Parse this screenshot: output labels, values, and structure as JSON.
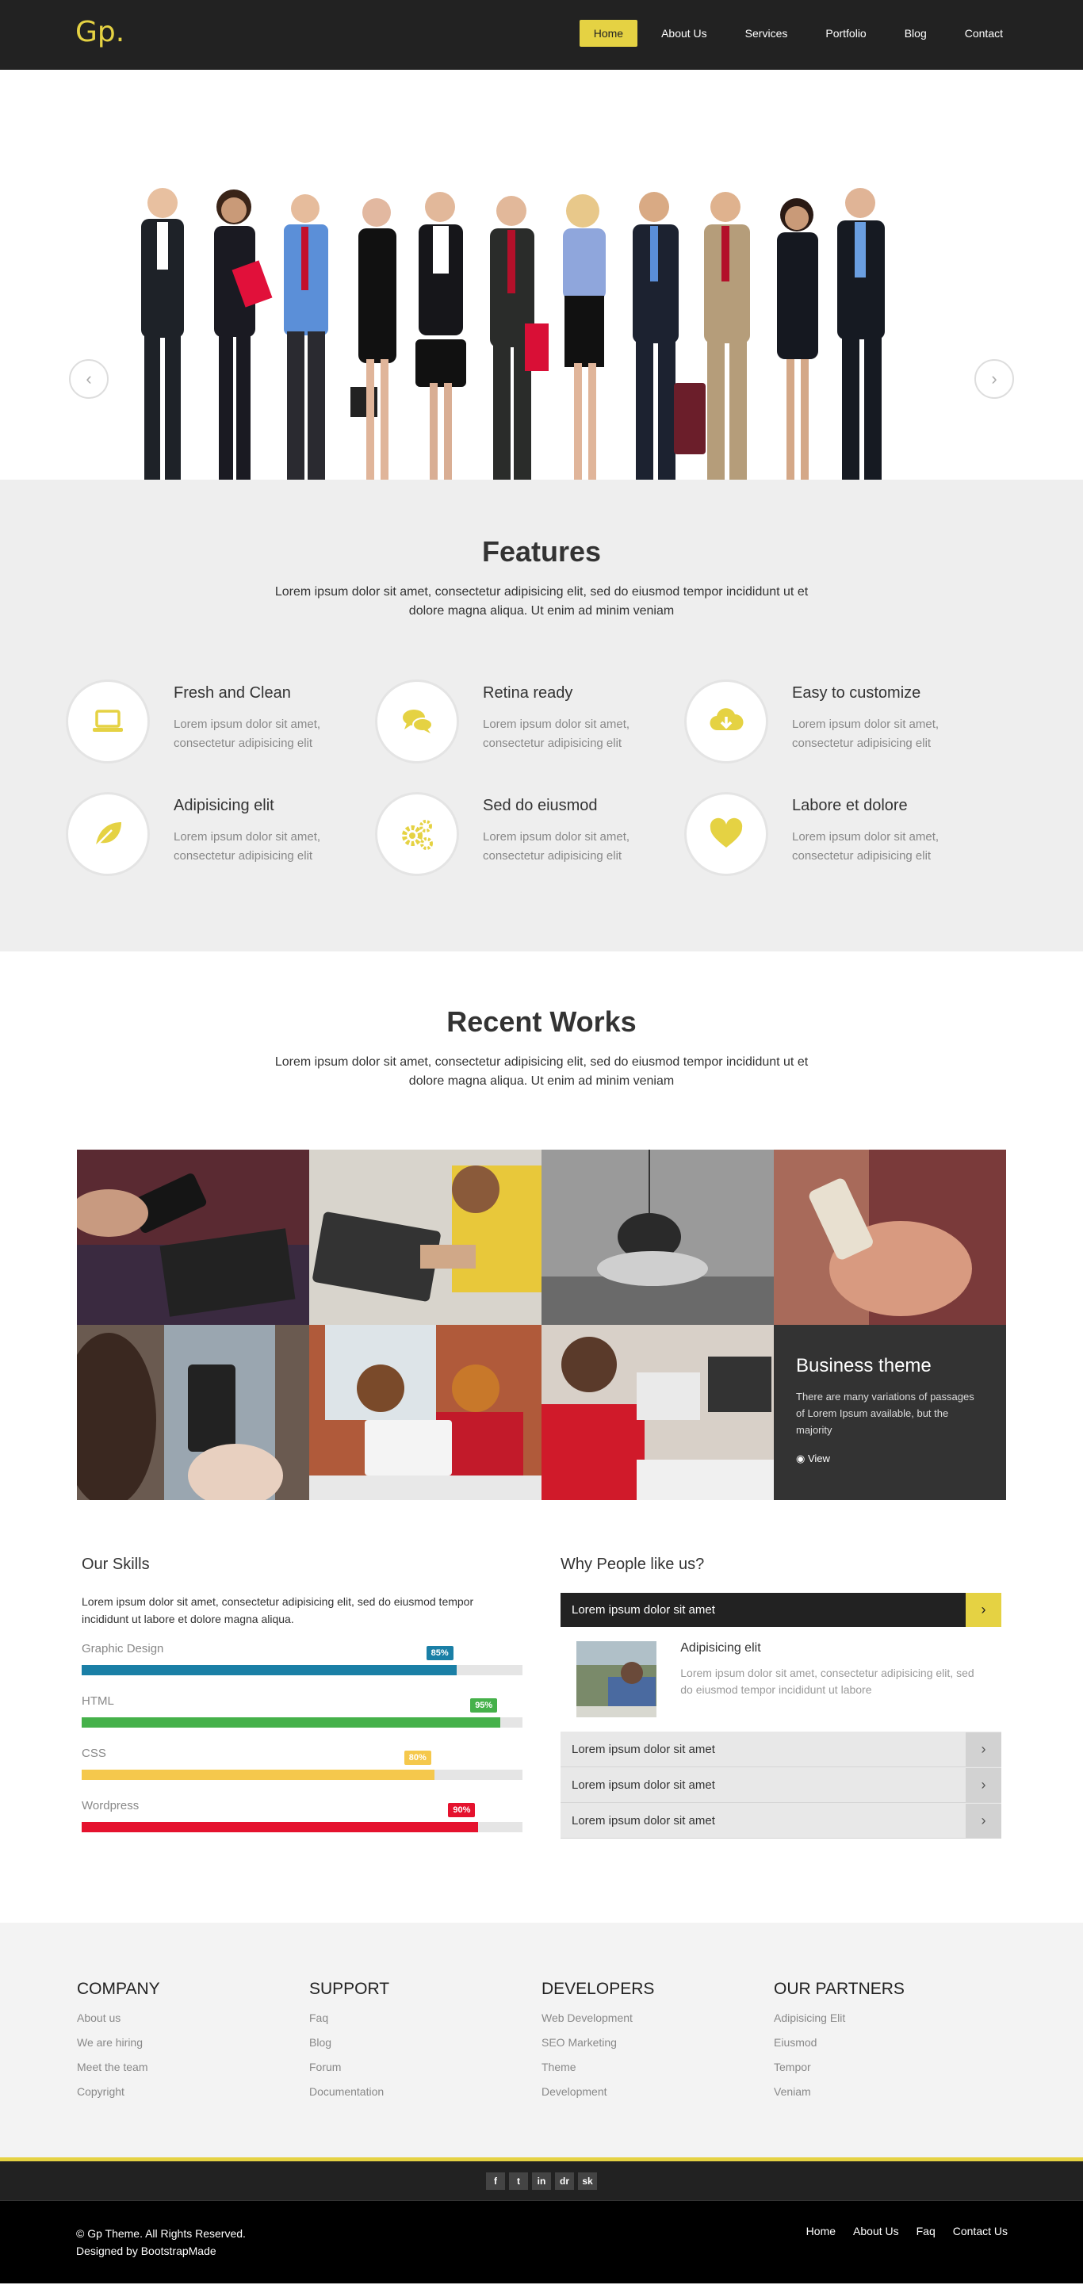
{
  "header": {
    "logo": "Gp.",
    "nav": [
      "Home",
      "About Us",
      "Services",
      "Portfolio",
      "Blog",
      "Contact"
    ],
    "active_nav": "Home"
  },
  "hero": {
    "prev_icon": "chevron-left-icon",
    "next_icon": "chevron-right-icon"
  },
  "features": {
    "title": "Features",
    "subtitle": "Lorem ipsum dolor sit amet, consectetur adipisicing elit, sed do eiusmod tempor incididunt ut et dolore magna aliqua. Ut enim ad minim veniam",
    "items": [
      {
        "title": "Fresh and Clean",
        "text": "Lorem ipsum dolor sit amet, consectetur adipisicing elit",
        "icon": "laptop-icon"
      },
      {
        "title": "Retina ready",
        "text": "Lorem ipsum dolor sit amet, consectetur adipisicing elit",
        "icon": "chat-bubbles-icon"
      },
      {
        "title": "Easy to customize",
        "text": "Lorem ipsum dolor sit amet, consectetur adipisicing elit",
        "icon": "cloud-download-icon"
      },
      {
        "title": "Adipisicing elit",
        "text": "Lorem ipsum dolor sit amet, consectetur adipisicing elit",
        "icon": "leaf-icon"
      },
      {
        "title": "Sed do eiusmod",
        "text": "Lorem ipsum dolor sit amet, consectetur adipisicing elit",
        "icon": "gears-icon"
      },
      {
        "title": "Labore et dolore",
        "text": "Lorem ipsum dolor sit amet, consectetur adipisicing elit",
        "icon": "heart-icon"
      }
    ],
    "accent": "#e5d243"
  },
  "works": {
    "title": "Recent Works",
    "subtitle": "Lorem ipsum dolor sit amet, consectetur adipisicing elit, sed do eiusmod tempor incididunt ut et dolore magna aliqua. Ut enim ad minim veniam",
    "overlay": {
      "title": "Business theme",
      "text": "There are many variations of passages of Lorem Ipsum available, but the majority",
      "view_label": "View",
      "view_icon": "eye-icon"
    }
  },
  "skills": {
    "title": "Our Skills",
    "intro": "Lorem ipsum dolor sit amet, consectetur adipisicing elit, sed do eiusmod tempor incididunt ut labore et dolore magna aliqua.",
    "items": [
      {
        "name": "Graphic Design",
        "percent": 85,
        "label": "85%",
        "color": "#1a7fa6"
      },
      {
        "name": "HTML",
        "percent": 95,
        "label": "95%",
        "color": "#45b14a"
      },
      {
        "name": "CSS",
        "percent": 80,
        "label": "80%",
        "color": "#f5c84c"
      },
      {
        "name": "Wordpress",
        "percent": 90,
        "label": "90%",
        "color": "#e5122e"
      }
    ]
  },
  "why": {
    "title": "Why People like us?",
    "open_item": {
      "header": "Lorem ipsum dolor sit amet",
      "title": "Adipisicing elit",
      "text": "Lorem ipsum dolor sit amet, consectetur adipisicing elit, sed do eiusmod tempor incididunt ut labore"
    },
    "items": [
      "Lorem ipsum dolor sit amet",
      "Lorem ipsum dolor sit amet",
      "Lorem ipsum dolor sit amet"
    ]
  },
  "footer": {
    "columns": [
      {
        "title": "COMPANY",
        "links": [
          "About us",
          "We are hiring",
          "Meet the team",
          "Copyright"
        ]
      },
      {
        "title": "SUPPORT",
        "links": [
          "Faq",
          "Blog",
          "Forum",
          "Documentation"
        ]
      },
      {
        "title": "DEVELOPERS",
        "links": [
          "Web Development",
          "SEO Marketing",
          "Theme",
          "Development"
        ]
      },
      {
        "title": "OUR PARTNERS",
        "links": [
          "Adipisicing Elit",
          "Eiusmod",
          "Tempor",
          "Veniam"
        ]
      }
    ],
    "social": [
      "f",
      "t",
      "in",
      "dr",
      "sk"
    ],
    "copyright": "© Gp Theme. All Rights Reserved.",
    "designed_by": "Designed by BootstrapMade",
    "bottom_nav": [
      "Home",
      "About Us",
      "Faq",
      "Contact Us"
    ]
  }
}
